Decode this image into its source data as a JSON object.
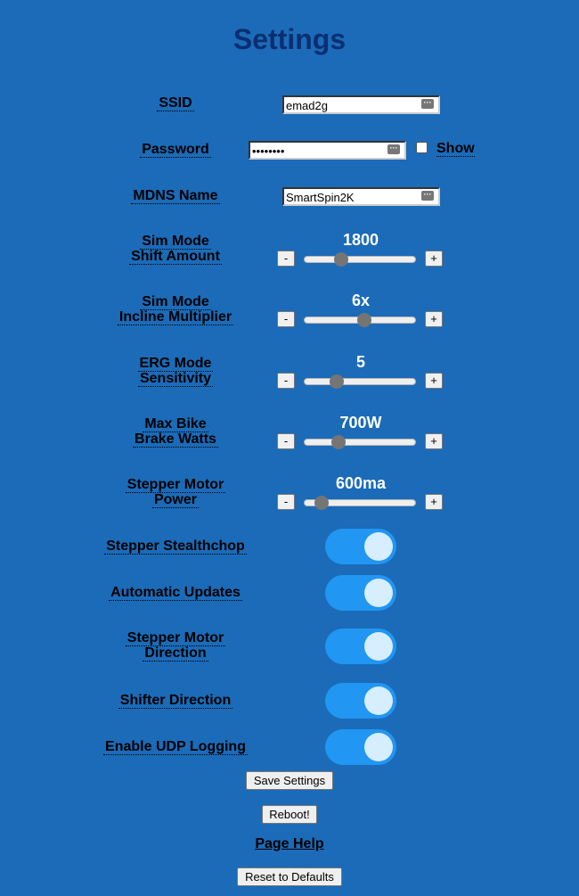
{
  "page": {
    "title": "Settings"
  },
  "fields": {
    "ssid": {
      "label": "SSID",
      "value": "emad2g"
    },
    "password": {
      "label": "Password",
      "value": "••••••••",
      "show_label": "Show"
    },
    "mdns": {
      "label": "MDNS Name",
      "value": "SmartSpin2K"
    }
  },
  "sliders": [
    {
      "label_line1": "Sim Mode",
      "label_line2": "Shift Amount",
      "display": "1800",
      "position": 0.3,
      "minus": "-",
      "plus": "+"
    },
    {
      "label_line1": "Sim Mode",
      "label_line2": "Incline Multiplier",
      "display": "6x",
      "position": 0.54,
      "minus": "-",
      "plus": "+"
    },
    {
      "label_line1": "ERG Mode",
      "label_line2": "Sensitivity",
      "display": "5",
      "position": 0.25,
      "minus": "-",
      "plus": "+"
    },
    {
      "label_line1": "Max Bike",
      "label_line2": "Brake Watts",
      "display": "700W",
      "position": 0.27,
      "minus": "-",
      "plus": "+"
    },
    {
      "label_line1": "Stepper Motor",
      "label_line2": "Power",
      "display": "600ma",
      "position": 0.1,
      "minus": "-",
      "plus": "+"
    }
  ],
  "toggles": [
    {
      "label_line1": "Stepper Stealthchop",
      "label_line2": "",
      "on": true
    },
    {
      "label_line1": "Automatic Updates",
      "label_line2": "",
      "on": true
    },
    {
      "label_line1": "Stepper Motor",
      "label_line2": "Direction",
      "on": true
    },
    {
      "label_line1": "Shifter Direction",
      "label_line2": "",
      "on": true
    },
    {
      "label_line1": "Enable UDP Logging",
      "label_line2": "",
      "on": true
    }
  ],
  "actions": {
    "save": "Save Settings",
    "reboot": "Reboot!",
    "help": "Page Help",
    "reset": "Reset to Defaults"
  },
  "colors": {
    "background": "#1b6bb8",
    "title": "#0b2e72",
    "switch_on": "#2196f3"
  }
}
